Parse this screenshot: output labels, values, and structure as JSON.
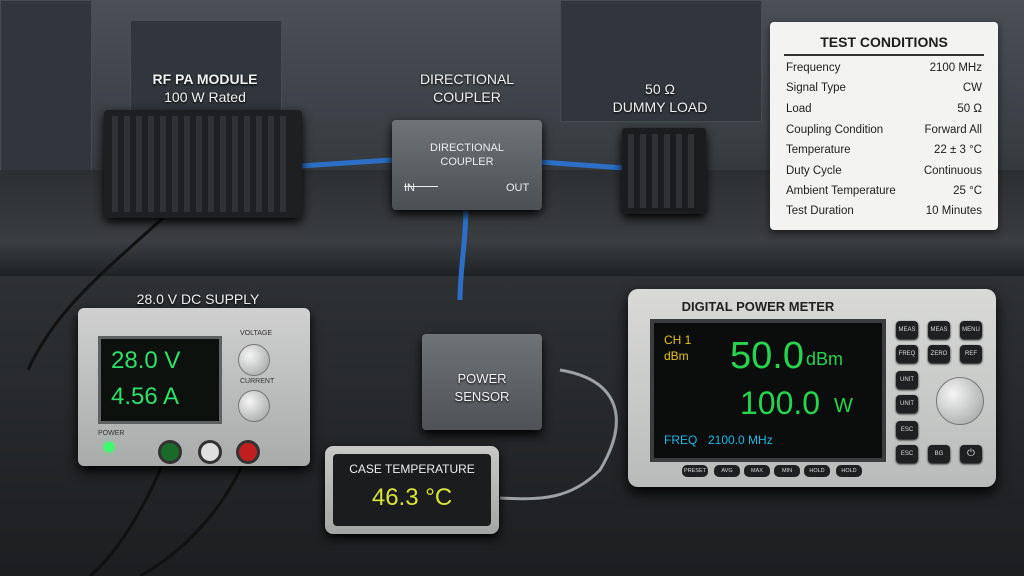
{
  "labels": {
    "pa_line1": "RF PA MODULE",
    "pa_line2": "100 W Rated",
    "coupler_line1": "DIRECTIONAL",
    "coupler_line2": "COUPLER",
    "load_line1": "50 Ω",
    "load_line2": "DUMMY LOAD"
  },
  "coupler": {
    "face_line1": "DIRECTIONAL",
    "face_line2": "COUPLER",
    "in": "IN",
    "out": "OUT"
  },
  "test_conditions": {
    "title": "TEST CONDITIONS",
    "rows": [
      {
        "key": "Frequency",
        "value": "2100 MHz"
      },
      {
        "key": "Signal Type",
        "value": "CW"
      },
      {
        "key": "Load",
        "value": "50 Ω"
      },
      {
        "key": "Coupling Condition",
        "value": "Forward All"
      },
      {
        "key": "Temperature",
        "value": "22 ± 3 °C"
      },
      {
        "key": "Duty Cycle",
        "value": "Continuous"
      },
      {
        "key": "Ambient Temperature",
        "value": "25 °C"
      },
      {
        "key": "Test Duration",
        "value": "10 Minutes"
      }
    ]
  },
  "dc_supply": {
    "title": "28.0 V DC SUPPLY",
    "voltage": "28.0 V",
    "current": "4.56 A",
    "voltage_knob": "VOLTAGE",
    "current_knob": "CURRENT",
    "power_label": "POWER",
    "led_color": "#3bff6b"
  },
  "sensor": {
    "line1": "POWER",
    "line2": "SENSOR"
  },
  "case_temp": {
    "title": "CASE TEMPERATURE",
    "value": "46.3 °C",
    "value_color": "#d8e43a"
  },
  "meter": {
    "title": "DIGITAL POWER METER",
    "channel": "CH 1",
    "unit": "dBm",
    "dbm_value": "50.0",
    "dbm_unit": "dBm",
    "watt_value": "100.0",
    "watt_unit": "W",
    "freq_label": "FREQ",
    "freq_value": "2100.0 MHz",
    "display_color": "#27d44f",
    "label_color": "#e8c21c",
    "freq_color": "#22b8e6",
    "side_buttons": [
      "MEAS",
      "MEAS",
      "MENU",
      "FREQ",
      "ZERO",
      "REF",
      "UNIT",
      "UNIT",
      "ESC",
      "ESC",
      "BG"
    ],
    "bottom_buttons": [
      "PRESET",
      "AVG",
      "MAX",
      "MIN",
      "HOLD",
      "HOLD"
    ]
  }
}
